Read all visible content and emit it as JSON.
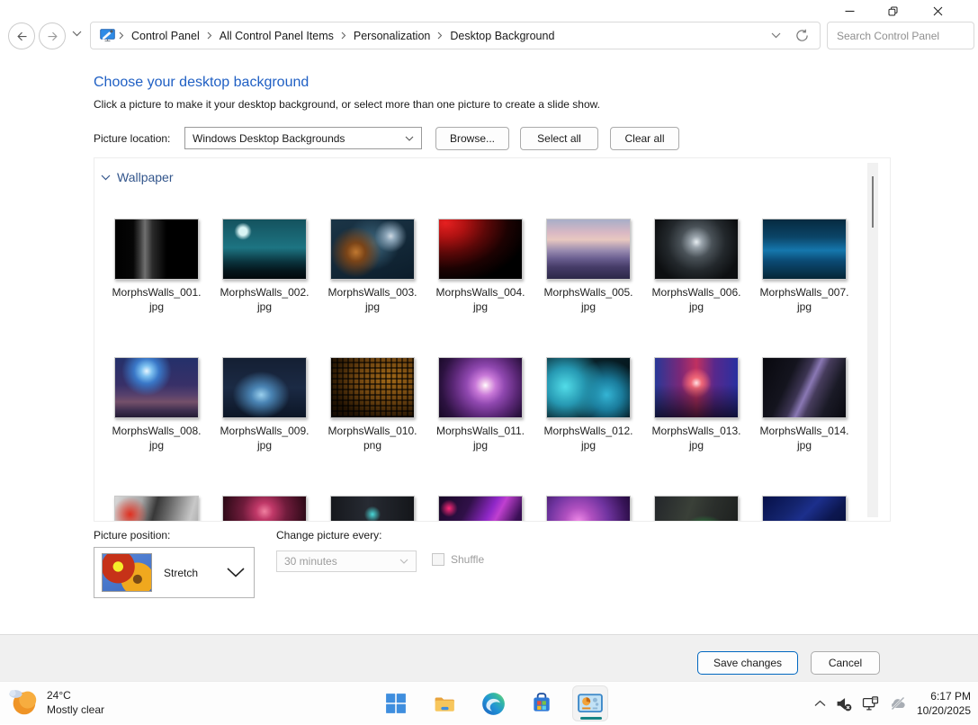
{
  "nav": {
    "breadcrumb": [
      "Control Panel",
      "All Control Panel Items",
      "Personalization",
      "Desktop Background"
    ],
    "search_placeholder": "Search Control Panel"
  },
  "page": {
    "title": "Choose your desktop background",
    "subtitle": "Click a picture to make it your desktop background, or select more than one picture to create a slide show.",
    "picture_location_label": "Picture location:",
    "picture_location_value": "Windows Desktop Backgrounds",
    "browse_label": "Browse...",
    "select_all_label": "Select all",
    "clear_all_label": "Clear all"
  },
  "wallpapers": {
    "group_label": "Wallpaper",
    "items": [
      {
        "file": "MorphsWalls_001.jpg",
        "bg": "linear-gradient(90deg,#000 0%,#060606 22%,#3c3c3c 30%,#707070 36%,#2b2b2b 45%,#000 62%,#000 100%)"
      },
      {
        "file": "MorphsWalls_002.jpg",
        "bg": "radial-gradient(circle at 24% 20%,#d8f4f4 0%,#d8f4f4 5%,rgba(216,244,244,0) 11%),linear-gradient(180deg,#14525e 0%,#1d7482 48%,#0a323c 72%,#04161c 86%,#02090c 100%)"
      },
      {
        "file": "MorphsWalls_003.jpg",
        "bg": "radial-gradient(circle at 72% 28%,#cfd9e2 0%,#8fa8bb 6%,rgba(20,40,60,0) 22%),radial-gradient(circle at 30% 55%,#c07830 0%,#7a4418 14%,rgba(30,20,10,0) 38%),radial-gradient(circle at 50% 40%,#3f6a82 0%,rgba(20,40,55,0) 50%),linear-gradient(160deg,#1b3547 0%,#0c1d2b 100%)"
      },
      {
        "file": "MorphsWalls_004.jpg",
        "bg": "radial-gradient(ellipse at 8% 6%,#e62020 0%,#b01212 18%,#5c0808 38%,#1c0202 58%,#000 78%)"
      },
      {
        "file": "MorphsWalls_005.jpg",
        "bg": "linear-gradient(180deg,#a8aec8 0%,#d9b8c4 22%,#e8c8c0 34%,#9a8cb0 52%,#6a5e90 66%,#463c68 80%,#2c2848 100%)"
      },
      {
        "file": "MorphsWalls_006.jpg",
        "bg": "radial-gradient(circle at 50% 38%,#e8eef2 0%,#9aa4ac 10%,#4a5258 28%,#23282c 52%,#0d0f11 80%)"
      },
      {
        "file": "MorphsWalls_007.jpg",
        "bg": "linear-gradient(180deg,#062a40 0%,#0b4568 30%,#1577ad 52%,#0b4a74 70%,#052636 100%)"
      },
      {
        "file": "MorphsWalls_008.jpg",
        "bg": "radial-gradient(circle at 38% 22%,#e8f6ff 0%,#7cc0f0 8%,#3a78c8 18%,rgba(40,60,140,0) 36%),linear-gradient(180deg,#24306a 0%,#383068 45%,#56406c 62%,#74506a 74%,#403050 88%,#241c34 100%)"
      },
      {
        "file": "MorphsWalls_009.jpg",
        "bg": "radial-gradient(ellipse at 46% 62%,#9ad0ee 0%,#4a84b4 16%,rgba(30,60,100,0) 45%),linear-gradient(180deg,#141f33 0%,#1b2a44 50%,#0c1626 100%)"
      },
      {
        "file": "MorphsWalls_010.png",
        "bg": "repeating-linear-gradient(90deg,rgba(0,0,0,.55) 0 2px,rgba(0,0,0,0) 2px 6px),repeating-linear-gradient(0deg,rgba(0,0,0,.55) 0 2px,rgba(0,0,0,0) 2px 6px),radial-gradient(ellipse at 70% 35%,#a06818 0%,#6e4410 40%,#241403 75%,#0f0801 100%)"
      },
      {
        "file": "MorphsWalls_011.jpg",
        "bg": "radial-gradient(circle at 56% 46%,#ffffff 0%,#f0c8ec 6%,#c878d8 18%,#9048b0 34%,#5c2878 56%,#2c1240 78%,#160824 100%)"
      },
      {
        "file": "MorphsWalls_012.jpg",
        "bg": "radial-gradient(circle at 22% 48%,#52dce8 0%,#2698b2 26%,rgba(10,60,76,0) 55%),radial-gradient(circle at 72% 62%,#34b4d4 0%,#1a7c9c 22%,rgba(8,40,56,0) 50%),linear-gradient(135deg,#0a2830 0%,#041016 100%)"
      },
      {
        "file": "MorphsWalls_013.jpg",
        "bg": "linear-gradient(180deg,rgba(8,8,28,0) 45%,rgba(6,6,20,.75) 100%),radial-gradient(circle at 50% 42%,#ffe2e2 0%,#f06878 10%,rgba(180,40,90,0) 28%),linear-gradient(90deg,#283898 0%,#7a2878 30%,#c03060 50%,#58288c 72%,#2830a0 100%)"
      },
      {
        "file": "MorphsWalls_014.jpg",
        "bg": "linear-gradient(115deg,#08080e 0%,#14141e 32%,#3c3452 46%,#8a78b4 54%,#463c5c 62%,#1a1a26 78%,#0a0a10 100%)"
      }
    ],
    "partial_row": [
      {
        "bg": "radial-gradient(circle at 18% 30%,#e03020 0%,rgba(224,48,32,0) 22%),radial-gradient(circle at 56% 60%,#101010 0%,#101010 8%,rgba(16,16,16,0) 16%),linear-gradient(105deg,#d8d8d8 0%,#a8a8a8 28%,#383838 44%,#6a6a6a 58%,#c8c8c8 82%,#9a9a9a 100%)"
      },
      {
        "bg": "radial-gradient(circle at 50% 25%,#f080a0 0%,#c03868 14%,#701c3c 36%,#300a18 68%,#180408 100%)"
      },
      {
        "bg": "radial-gradient(circle at 48% 65%,#ff4040 0%,#c01818 8%,rgba(120,16,16,0) 18%),radial-gradient(circle at 50% 30%,#4ad8d8 0%,rgba(40,160,160,0) 14%),linear-gradient(90deg,#16181d 0%,#272b33 45%,#14161a 100%)"
      },
      {
        "bg": "radial-gradient(circle at 12% 20%,#ff2878 0%,rgba(255,40,120,0) 10%),linear-gradient(118deg,#180826 0%,#301048 30%,#9028c8 52%,#c040d0 60%,#3c1058 78%,#14041f 100%)"
      },
      {
        "bg": "radial-gradient(circle at 38% 42%,#f08ae8 0%,#b050c0 22%,#7034a0 48%,#381458 78%,#1c0830 100%)"
      },
      {
        "bg": "radial-gradient(ellipse at 60% 55%,#2c9a44 0%,rgba(30,110,50,0) 30%),linear-gradient(108deg,#23262a 0%,#3a4038 38%,#2b2f2c 60%,#191c1a 100%)"
      },
      {
        "bg": "linear-gradient(135deg,#061048 0%,#14246e 28%,#1c2f8c 42%,#0c1750 62%,#040a28 100%)"
      }
    ]
  },
  "position": {
    "label": "Picture position:",
    "value": "Stretch",
    "thumb_bg": "radial-gradient(circle at 32% 34%,#f5ef2a 0 12%,#c63218 13% 40%,rgba(0,0,0,0) 41%),radial-gradient(circle at 72% 68%,#7a4a14 0 10%,#f0a81e 11% 38%,rgba(0,0,0,0) 39%),linear-gradient(160deg,#5585d8 0%,#3f6cc0 100%)"
  },
  "change_every": {
    "label": "Change picture every:",
    "value": "30 minutes",
    "shuffle_label": "Shuffle"
  },
  "footer": {
    "save_label": "Save changes",
    "cancel_label": "Cancel"
  },
  "taskbar": {
    "weather": {
      "temp": "24°C",
      "condition": "Mostly clear"
    },
    "clock": {
      "time": "6:17 PM",
      "date": "10/20/2025"
    }
  },
  "colors": {
    "accent": "#0067c0",
    "heading_blue": "#2060c4",
    "group_header_blue": "#33568c",
    "active_app_indicator": "#178585"
  },
  "icons": {
    "back": "left-arrow-in-circle",
    "forward": "right-arrow-in-circle",
    "recent-locations": "chevron-down",
    "address-app": "personalization-monitor-brush",
    "breadcrumb-separator": "chevron-right",
    "address-dropdown": "chevron-down",
    "refresh": "circular-arrow",
    "search": "magnifier",
    "minimize": "dash",
    "maximize": "overlapping-squares",
    "close": "x",
    "wallpaper-group": "chevron-down",
    "combo": "chevron-down",
    "weather": "moon-with-cloud",
    "start": "windows-logo",
    "explorer": "folder",
    "edge": "swirl-circle",
    "store": "shopping-bag",
    "control-panel": "monitor-pie-chart",
    "tray-expand": "chevron-up",
    "volume": "speaker-muted",
    "network": "monitor-plug",
    "onedrive": "cloud-slashed"
  }
}
